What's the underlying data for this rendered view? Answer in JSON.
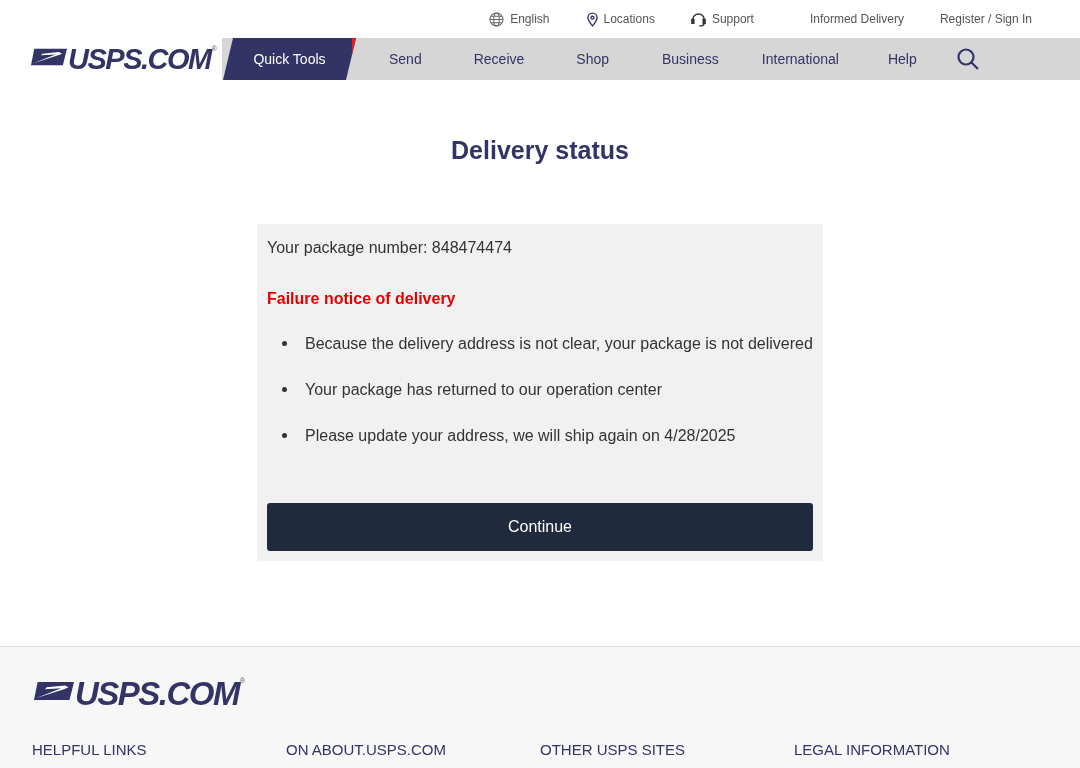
{
  "top_links": [
    {
      "kind": "globe",
      "label": "English"
    },
    {
      "kind": "pin",
      "label": "Locations"
    },
    {
      "kind": "headset",
      "label": "Support"
    },
    {
      "kind": "plain",
      "label": "Informed Delivery"
    },
    {
      "kind": "plain",
      "label": "Register / Sign In"
    }
  ],
  "logo": {
    "text": "USPS.COM",
    "mark": "®"
  },
  "nav": [
    {
      "label": "Quick Tools",
      "selected": true
    },
    {
      "label": "Send",
      "selected": false
    },
    {
      "label": "Receive",
      "selected": false
    },
    {
      "label": "Shop",
      "selected": false
    },
    {
      "label": "Business",
      "selected": false
    },
    {
      "label": "International",
      "selected": false
    },
    {
      "label": "Help",
      "selected": false
    }
  ],
  "title": "Delivery status",
  "card": {
    "package_line": "Your package number: 848474474",
    "notice": "Failure notice of delivery",
    "bullets": [
      "Because the delivery address is not clear, your package is not delivered",
      "Your package has returned to our operation center",
      "Please update your address, we will ship again on 4/28/2025"
    ],
    "button": "Continue"
  },
  "footer": {
    "logo": {
      "text": "USPS.COM",
      "mark": "®"
    },
    "headings": [
      "HELPFUL LINKS",
      "ON ABOUT.USPS.COM",
      "OTHER USPS SITES",
      "LEGAL INFORMATION"
    ]
  }
}
